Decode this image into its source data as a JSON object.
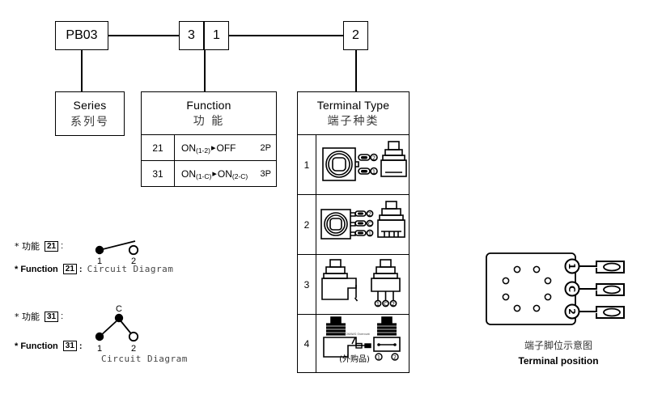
{
  "part_number": {
    "series_code": "PB03",
    "function_code_digits": [
      "3",
      "1"
    ],
    "terminal_code": "2"
  },
  "series": {
    "title_en": "Series",
    "title_cn": "系列号"
  },
  "function": {
    "title_en": "Function",
    "title_cn": "功 能",
    "rows": [
      {
        "code": "21",
        "state_a": "ON",
        "state_a_sub": "(1-2)",
        "arrow": "▸",
        "state_b": "OFF",
        "state_b_sub": "",
        "poles": "2P"
      },
      {
        "code": "31",
        "state_a": "ON",
        "state_a_sub": "(1-C)",
        "arrow": "▸",
        "state_b": "ON",
        "state_b_sub": "(2-C)",
        "poles": "3P"
      }
    ]
  },
  "terminal_type": {
    "title_en": "Terminal Type",
    "title_cn": "端子种类",
    "rows": [
      {
        "no": "1",
        "terminal_labels": [
          "2",
          "1"
        ],
        "note": ""
      },
      {
        "no": "2",
        "terminal_labels": [
          "2",
          "C",
          "1"
        ],
        "note": ""
      },
      {
        "no": "3",
        "terminal_labels": [
          "1",
          "C",
          "2"
        ],
        "note": ""
      },
      {
        "no": "4",
        "terminal_labels": [
          "1",
          "2"
        ],
        "note": "(外购品)",
        "wire_label": "#26AWG Overcoat"
      }
    ]
  },
  "circuit_notes": [
    {
      "label_cn": "* 功能",
      "label_en": "* Function",
      "code": "21",
      "caption": "Circuit Diagram",
      "terminals": [
        "1",
        "2"
      ]
    },
    {
      "label_cn": "* 功能",
      "label_en": "* Function",
      "code": "31",
      "caption": "Circuit Diagram",
      "terminals": [
        "1",
        "2"
      ],
      "common": "C"
    }
  ],
  "terminal_position": {
    "caption_cn": "端子脚位示意图",
    "caption_en": "Terminal position",
    "pin_labels": [
      "1",
      "C",
      "2"
    ]
  },
  "colors": {
    "stroke": "#000000",
    "background": "#ffffff",
    "cn_text": "#3a3a3a"
  }
}
